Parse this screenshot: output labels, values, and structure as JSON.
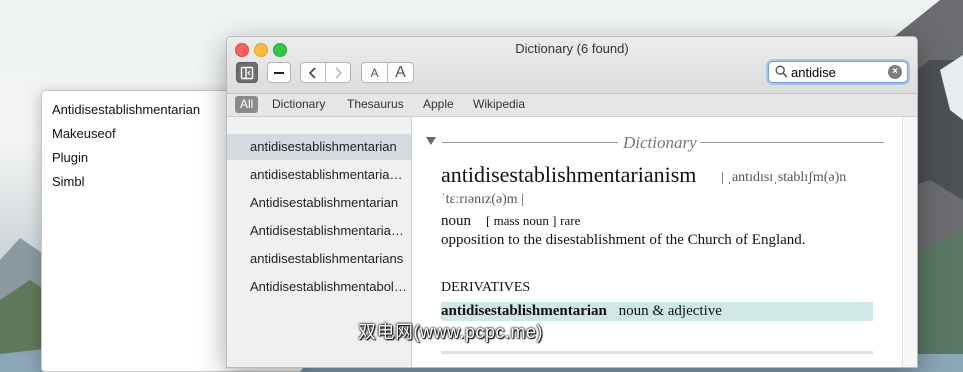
{
  "window": {
    "title": "Dictionary (6 found)"
  },
  "toolbar": {
    "font_smaller": "A",
    "font_larger": "A"
  },
  "search": {
    "value": "antidise",
    "clear_label": "×"
  },
  "filters": [
    "All",
    "Dictionary",
    "Thesaurus",
    "Apple",
    "Wikipedia"
  ],
  "results": [
    "antidisestablishmentarian",
    "antidisestablishmentarianism",
    "Antidisestablishmentarian",
    "Antidisestablishmentarianism",
    "antidisestablishmentarians",
    "Antidisestablishmentabolitionism"
  ],
  "entry": {
    "section": "Dictionary",
    "headword": "antidisestablishmentarianism",
    "pronunciation_line1": "| ˌantɪdɪsɪˌstablɪʃm(ə)n",
    "pronunciation_line2": "ˈtɛːrɪənɪz(ə)m |",
    "part_of_speech": "noun",
    "grammar_note": "[ mass noun ]",
    "register": "rare",
    "definition": "opposition to the disestablishment of the Church of England.",
    "derivatives_heading": "DERIVATIVES",
    "derivative_word": "antidisestablishmentarian",
    "derivative_pos": "noun & adjective"
  },
  "back_window": {
    "items": [
      "Antidisestablishmentarian",
      "Makeuseof",
      "Plugin",
      "Simbl"
    ]
  },
  "watermark": "双电网(www.pcpc.me)",
  "colors": {
    "accent": "#6c9ee6",
    "highlight": "#cfe8e6",
    "selection": "#d5d9e0"
  }
}
